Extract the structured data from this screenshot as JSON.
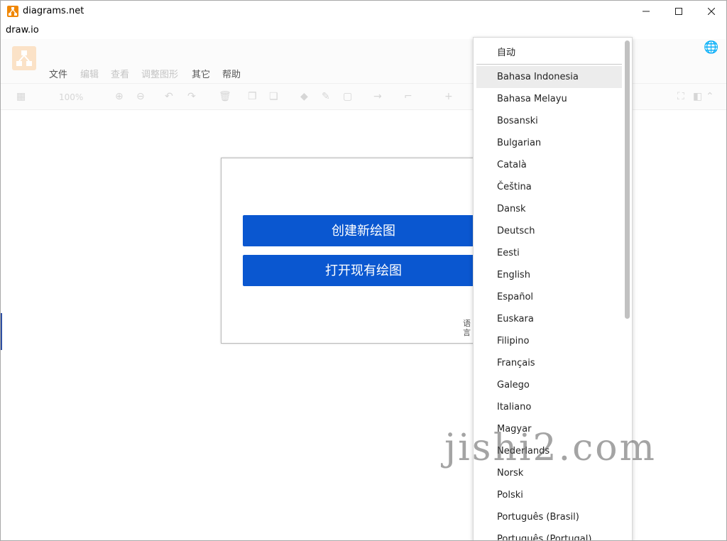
{
  "window": {
    "title": "diagrams.net"
  },
  "electron_menu": {
    "label": "draw.io"
  },
  "app_menu": [
    {
      "label": "文件",
      "dim": false
    },
    {
      "label": "编辑",
      "dim": true
    },
    {
      "label": "查看",
      "dim": true
    },
    {
      "label": "调整图形",
      "dim": true
    },
    {
      "label": "其它",
      "dim": false
    },
    {
      "label": "帮助",
      "dim": false
    }
  ],
  "toolbar": {
    "zoom": "100%"
  },
  "splash": {
    "create_label": "创建新绘图",
    "open_label": "打开现有绘图",
    "language_label": "语言"
  },
  "language_menu": {
    "auto": "自动",
    "hovered_index": 0,
    "items": [
      "Bahasa Indonesia",
      "Bahasa Melayu",
      "Bosanski",
      "Bulgarian",
      "Català",
      "Čeština",
      "Dansk",
      "Deutsch",
      "Eesti",
      "English",
      "Español",
      "Euskara",
      "Filipino",
      "Français",
      "Galego",
      "Italiano",
      "Magyar",
      "Nederlands",
      "Norsk",
      "Polski",
      "Português (Brasil)",
      "Português (Portugal)"
    ]
  },
  "watermark": "jishi2.com",
  "colors": {
    "primary_button": "#0a57d0",
    "logo_orange": "#f08705"
  }
}
